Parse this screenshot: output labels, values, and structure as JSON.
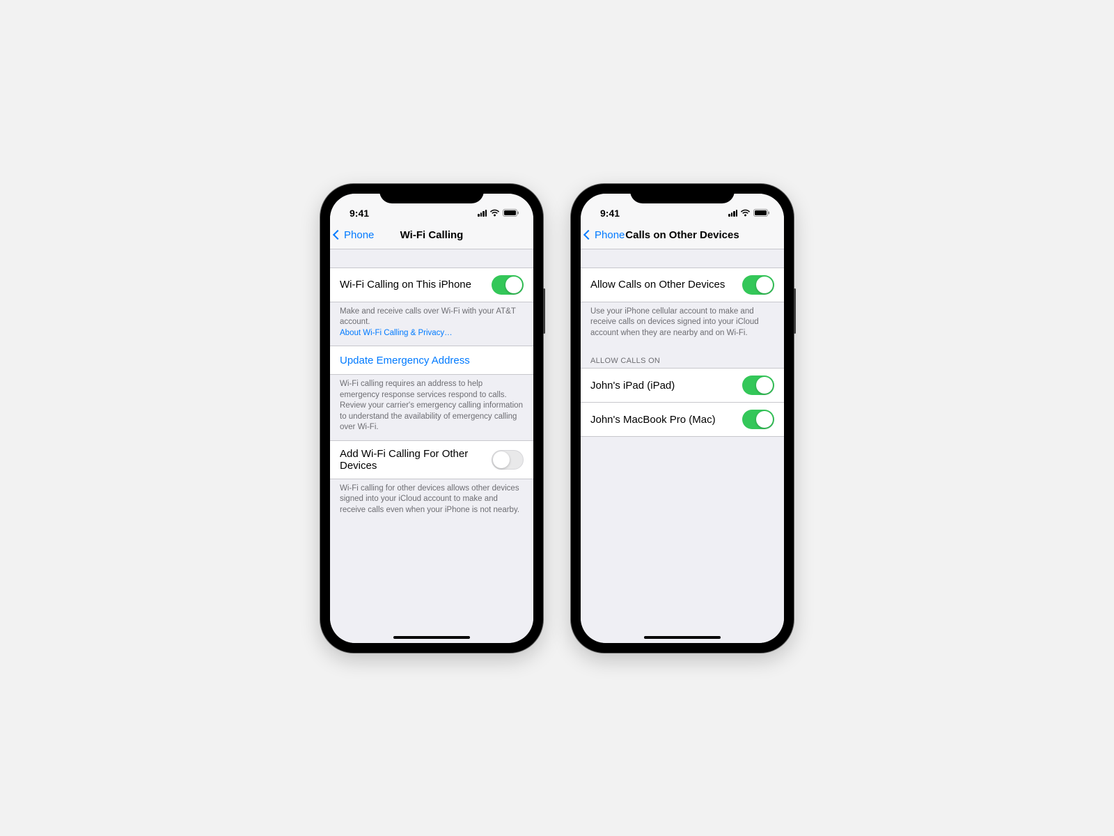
{
  "status": {
    "time": "9:41"
  },
  "colors": {
    "link": "#007aff",
    "toggle_on": "#34c759"
  },
  "phone1": {
    "nav": {
      "back": "Phone",
      "title": "Wi-Fi Calling"
    },
    "row_wifi_calling": {
      "label": "Wi-Fi Calling on This iPhone",
      "on": true
    },
    "footer_wifi_calling": {
      "text": "Make and receive calls over Wi-Fi with your AT&T account.",
      "link": "About Wi-Fi Calling & Privacy…"
    },
    "row_update_address": {
      "label": "Update Emergency Address"
    },
    "footer_update_address": "Wi-Fi calling requires an address to help emergency response services respond to calls. Review your carrier's emergency calling information to understand the availability of emergency calling over Wi-Fi.",
    "row_other_devices": {
      "label": "Add Wi-Fi Calling For Other Devices",
      "on": false
    },
    "footer_other_devices": "Wi-Fi calling for other devices allows other devices signed into your iCloud account to make and receive calls even when your iPhone is not nearby."
  },
  "phone2": {
    "nav": {
      "back": "Phone",
      "title": "Calls on Other Devices"
    },
    "row_allow": {
      "label": "Allow Calls on Other Devices",
      "on": true
    },
    "footer_allow": "Use your iPhone cellular account to make and receive calls on devices signed into your iCloud account when they are nearby and on Wi-Fi.",
    "section_header": "Allow Calls On",
    "devices": [
      {
        "label": "John's iPad (iPad)",
        "on": true
      },
      {
        "label": "John's MacBook Pro (Mac)",
        "on": true
      }
    ]
  }
}
